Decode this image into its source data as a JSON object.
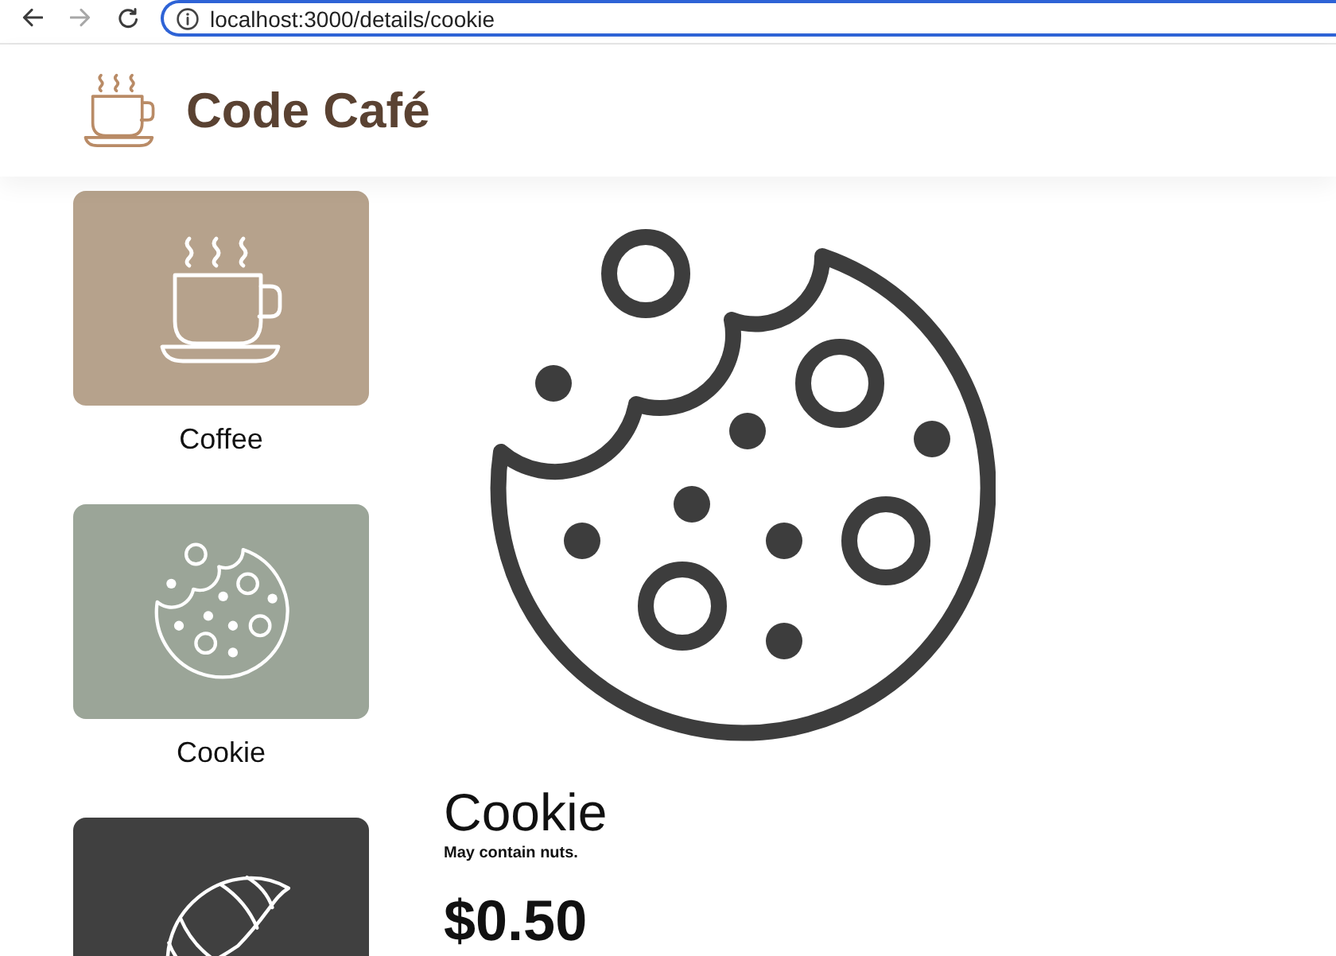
{
  "browser": {
    "url": "localhost:3000/details/cookie"
  },
  "header": {
    "title": "Code Café"
  },
  "menu": [
    {
      "kind": "coffee",
      "label": "Coffee",
      "color": "#b6a28c"
    },
    {
      "kind": "cookie",
      "label": "Cookie",
      "color": "#9ba598"
    },
    {
      "kind": "croissant",
      "color": "#404040"
    }
  ],
  "product": {
    "kind": "cookie",
    "name": "Cookie",
    "note": "May contain nuts.",
    "price": "$0.50"
  }
}
